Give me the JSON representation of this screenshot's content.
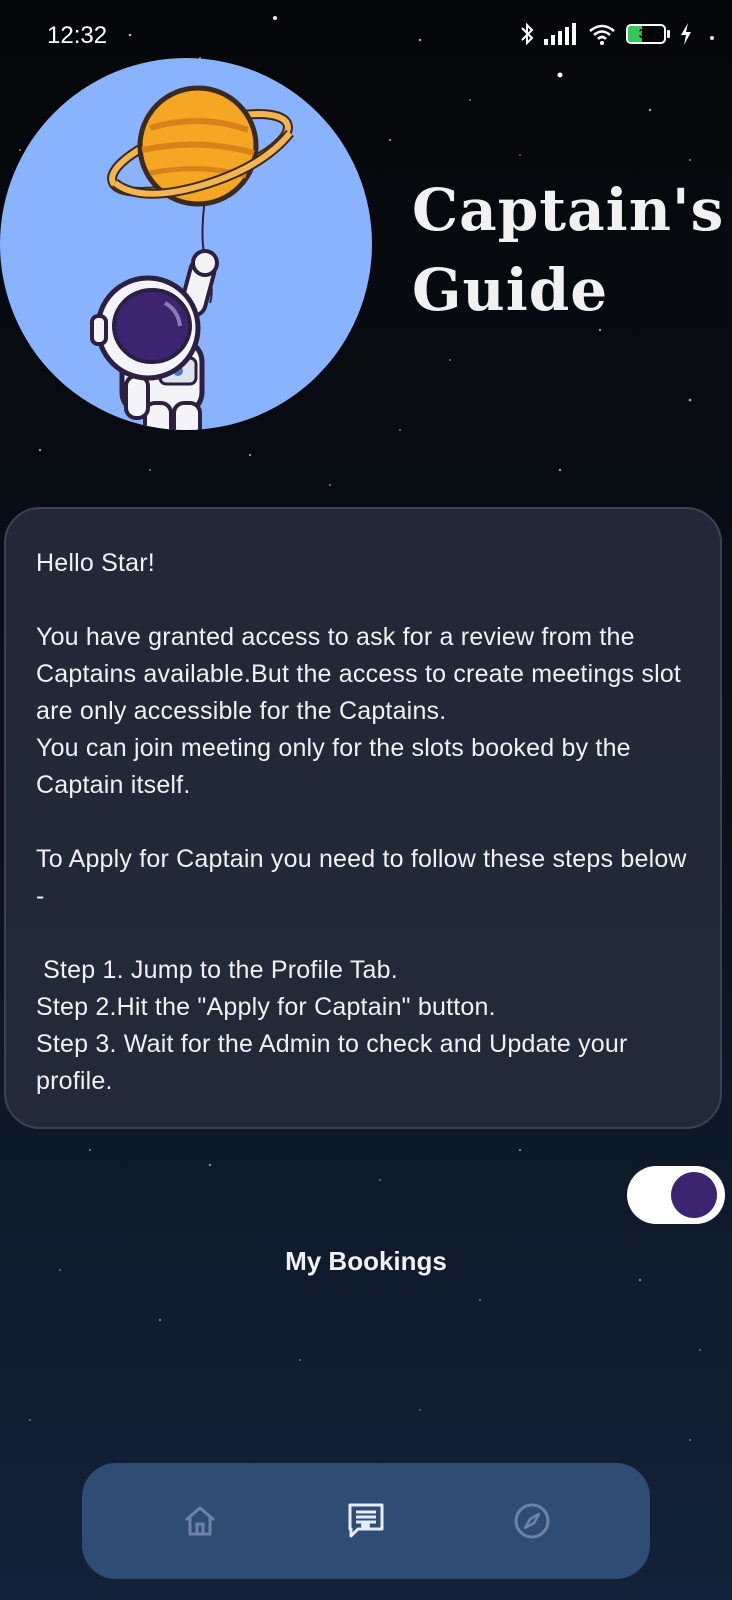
{
  "status_bar": {
    "time": "12:32",
    "battery_level": "38",
    "icons": [
      "bluetooth-icon",
      "signal-icon",
      "wifi-icon",
      "battery-icon",
      "charging-icon"
    ]
  },
  "hero": {
    "illustration": "astronaut-with-planet-balloon",
    "title_line1": "Captain's",
    "title_line2": "Guide"
  },
  "info_card": {
    "greeting": "Hello Star!",
    "paragraph1": "You have granted access to ask for a review from the Captains available.But the access to create meetings slot are only accessible for the Captains.",
    "paragraph2": "You can join meeting only for the slots booked by the Captain itself.",
    "paragraph3": "To Apply for Captain you need to follow these steps below -",
    "step1": " Step 1. Jump to the Profile Tab.",
    "step2": "Step 2.Hit the \"Apply for Captain\" button.",
    "step3": "Step 3. Wait for the Admin to check and Update your profile."
  },
  "toggle": {
    "on": true
  },
  "my_bookings_label": "My Bookings",
  "bottom_nav": {
    "items": [
      {
        "icon": "home-icon",
        "active": false
      },
      {
        "icon": "chat-icon",
        "active": true
      },
      {
        "icon": "compass-icon",
        "active": false
      }
    ]
  },
  "colors": {
    "hero_circle": "#89b2ff",
    "card_bg": "#262c3a",
    "nav_bg": "#2f4d73",
    "toggle_knob": "#3d2470",
    "battery_fill": "#35c759"
  }
}
